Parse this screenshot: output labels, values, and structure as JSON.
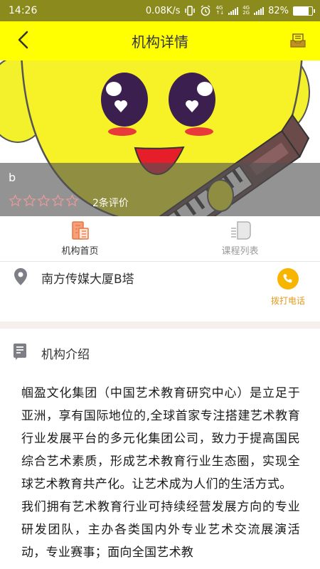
{
  "status_bar": {
    "time": "14:26",
    "speed": "0.08K/s",
    "net1": "4G",
    "net2": "4G",
    "net3": "2G",
    "battery": "82%",
    "battery_level": 0.82
  },
  "header": {
    "title": "机构详情",
    "back_icon": "chevron-left-icon",
    "message_icon": "mail-tray-icon"
  },
  "banner": {
    "org_name": "b",
    "rating_stars": 0,
    "rating_max": 5,
    "review_count": "2条评价"
  },
  "tabs": [
    {
      "label": "机构首页",
      "active": true,
      "icon": "building-icon"
    },
    {
      "label": "课程列表",
      "active": false,
      "icon": "course-list-icon"
    }
  ],
  "address": {
    "text": "南方传媒大厦B塔",
    "call_label": "拨打电话"
  },
  "intro": {
    "title": "机构介绍",
    "paragraphs": [
      "帼盈文化集团（中国艺术教育研究中心）是立足于亚洲，享有国际地位的,全球首家专注搭建艺术教育行业发展平台的多元化集团公司，致力于提高国民综合艺术素质，形成艺术教育行业生态圈，实现全球艺术教育共产化。让艺术成为人们的生活方式。",
      "我们拥有艺术教育行业可持续经营发展方向的专业研发团队，主办各类国内外专业艺术交流展演活动，专业赛事；面向全国艺术教"
    ]
  },
  "colors": {
    "header_bg": "#ffff01",
    "status_bg": "#8b8b1d",
    "accent_orange": "#f7b500",
    "call_text": "#e39a1a",
    "tab_active_icon": "#f08a50"
  }
}
